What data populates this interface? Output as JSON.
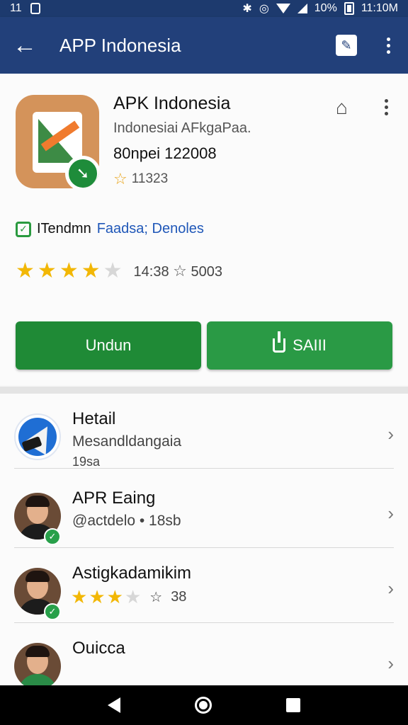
{
  "status_bar": {
    "left_text": "11",
    "battery_text": "10%",
    "time": "11:10M"
  },
  "app_bar": {
    "title": "APP Indonesia",
    "back_icon": "arrow-left-icon",
    "edit_icon": "edit-icon",
    "menu_icon": "more-vert-icon"
  },
  "app": {
    "name": "APK Indonesia",
    "subtitle": "Indonesiai AFkgaPaa.",
    "date": "80npei 122008",
    "small_rating": "11323",
    "trending_label": "ITendmn",
    "trending_link": "Faadsa; Denoles",
    "rating_value": 3.5,
    "rating_text": "14:38",
    "rating_count": "5003"
  },
  "buttons": {
    "install_label": "Undun",
    "share_label": "SAIII"
  },
  "list": [
    {
      "title": "Hetail",
      "subtitle": "Mesandldangaia",
      "subtitle2": "19sa",
      "avatar": "app-logo-icon"
    },
    {
      "title": "APR Eaing",
      "subtitle": "@actdelo • 18sb",
      "avatar": "person",
      "verified": true
    },
    {
      "title": "Astigkadamikim",
      "stars": 3,
      "count": "38",
      "avatar": "person",
      "verified": true
    },
    {
      "title": "Ouicca",
      "avatar": "person"
    }
  ],
  "colors": {
    "app_bar": "#22407a",
    "status_bar": "#1d3a6e",
    "button_green": "#1f8a36",
    "star": "#f2b705",
    "link": "#1f57b8"
  }
}
